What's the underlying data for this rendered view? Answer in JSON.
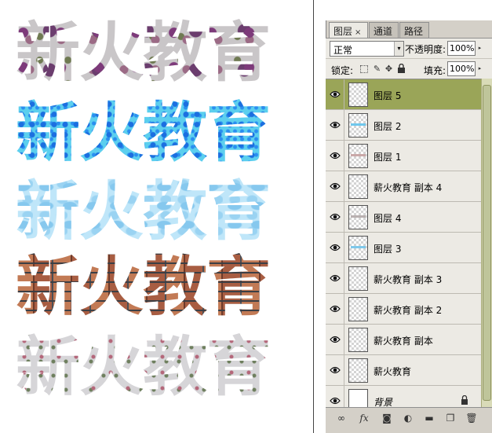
{
  "canvas": {
    "artwork": [
      {
        "text": "新火教育"
      },
      {
        "text": "新火教育"
      },
      {
        "text": "新火教育"
      },
      {
        "text": "新火教育"
      },
      {
        "text": "新火教育"
      }
    ]
  },
  "panel": {
    "tabs": [
      {
        "label": "图层",
        "active": true,
        "close": "×"
      },
      {
        "label": "通道",
        "active": false
      },
      {
        "label": "路径",
        "active": false
      }
    ],
    "blend_mode": "正常",
    "opacity_label": "不透明度:",
    "opacity_value": "100%",
    "lock_label": "锁定:",
    "fill_label": "填充:",
    "fill_value": "100%",
    "layers": [
      {
        "name": "图层 5",
        "selected": true,
        "visible": true
      },
      {
        "name": "图层 2",
        "selected": false,
        "visible": true
      },
      {
        "name": "图层 1",
        "selected": false,
        "visible": true
      },
      {
        "name": "薪火教育 副本 4",
        "selected": false,
        "visible": true
      },
      {
        "name": "图层 4",
        "selected": false,
        "visible": true
      },
      {
        "name": "图层 3",
        "selected": false,
        "visible": true
      },
      {
        "name": "薪火教育 副本 3",
        "selected": false,
        "visible": true
      },
      {
        "name": "薪火教育 副本 2",
        "selected": false,
        "visible": true
      },
      {
        "name": "薪火教育 副本",
        "selected": false,
        "visible": true
      },
      {
        "name": "薪火教育",
        "selected": false,
        "visible": true
      },
      {
        "name": "背景",
        "selected": false,
        "visible": true,
        "locked": true
      }
    ],
    "bottom_tools": [
      "link-icon",
      "fx-icon",
      "mask-icon",
      "adjustment-icon",
      "folder-icon",
      "new-layer-icon",
      "trash-icon"
    ],
    "accent_color": "#9aa558"
  }
}
